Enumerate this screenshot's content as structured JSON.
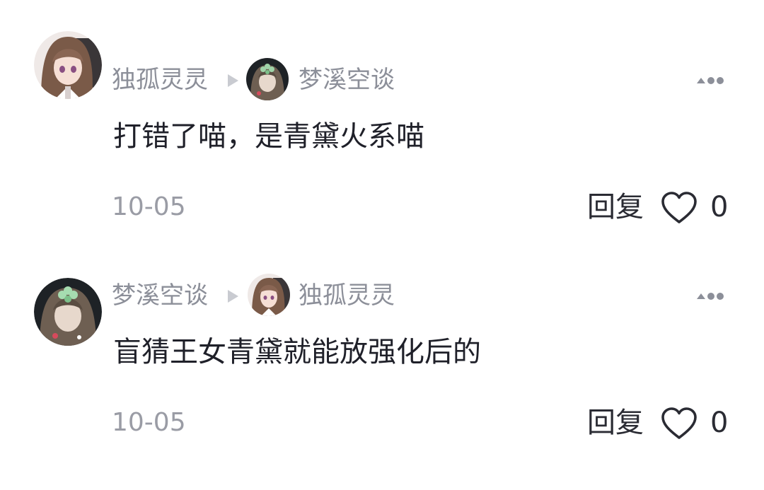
{
  "comments": [
    {
      "author": "独孤灵灵",
      "reply_to": "梦溪空谈",
      "text": "打错了喵，是青黛火系喵",
      "date": "10-05",
      "reply_label": "回复",
      "likes": "0",
      "author_avatar": "brown-hair-girl-avatar",
      "reply_to_avatar": "clover-hair-girl-avatar"
    },
    {
      "author": "梦溪空谈",
      "reply_to": "独孤灵灵",
      "text": "盲猜王女青黛就能放强化后的",
      "date": "10-05",
      "reply_label": "回复",
      "likes": "0",
      "author_avatar": "clover-hair-girl-avatar",
      "reply_to_avatar": "brown-hair-girl-avatar"
    }
  ],
  "colors": {
    "name": "#8c8f99",
    "body_text": "#1f2029",
    "date": "#9a9ca5",
    "action": "#2a2b33",
    "reply_arrow": "#c9cbd1"
  },
  "icons": {
    "more": "more-dots-icon",
    "like": "heart-outline-icon",
    "reply_arrow": "reply-arrow-icon"
  }
}
